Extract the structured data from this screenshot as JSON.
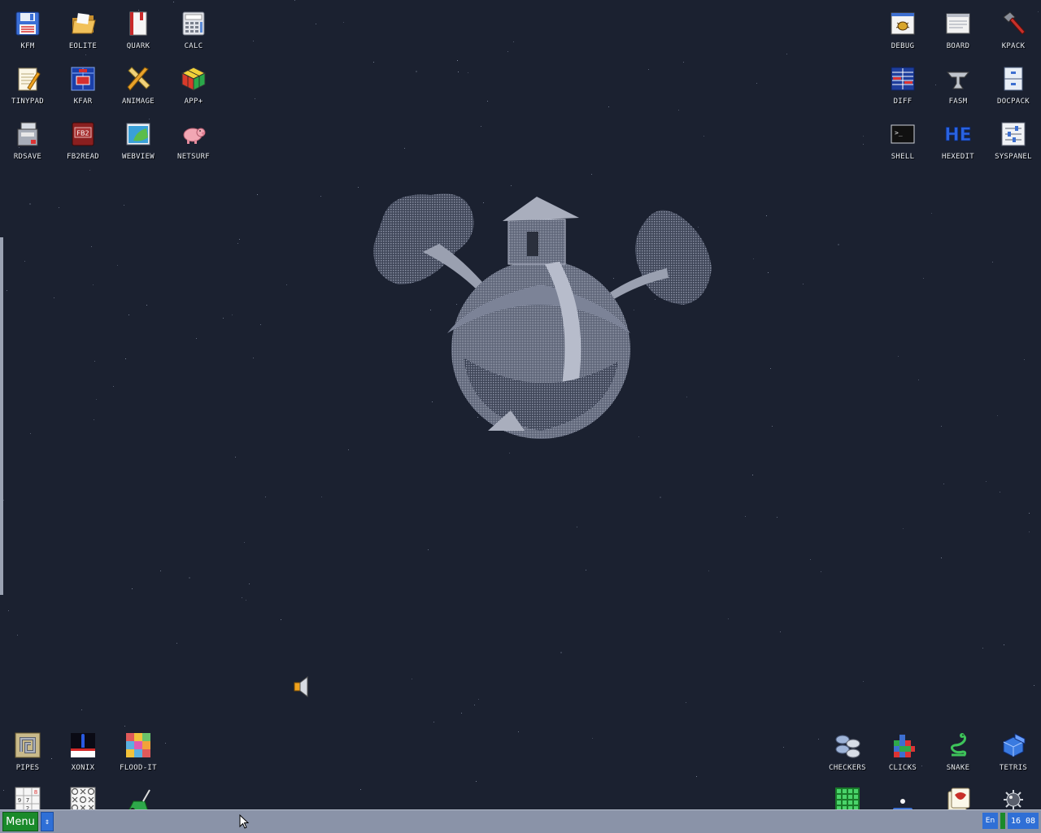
{
  "desktop": {
    "top_left_icons": [
      {
        "label": "KFM",
        "icon": "floppy-disk-icon"
      },
      {
        "label": "EOLITE",
        "icon": "folder-icon"
      },
      {
        "label": "QUARK",
        "icon": "book-icon"
      },
      {
        "label": "CALC",
        "icon": "calculator-icon"
      },
      {
        "label": "TINYPAD",
        "icon": "notepad-icon"
      },
      {
        "label": "KFAR",
        "icon": "archive-grid-icon"
      },
      {
        "label": "ANIMAGE",
        "icon": "pencil-ruler-icon"
      },
      {
        "label": "APP+",
        "icon": "cube-icon"
      },
      {
        "label": "RDSAVE",
        "icon": "disk-save-icon"
      },
      {
        "label": "FB2READ",
        "icon": "fb2-book-icon"
      },
      {
        "label": "WEBVIEW",
        "icon": "globe-window-icon"
      },
      {
        "label": "NETSURF",
        "icon": "pig-icon"
      }
    ],
    "top_right_icons": [
      {
        "label": "DEBUG",
        "icon": "bug-window-icon"
      },
      {
        "label": "BOARD",
        "icon": "board-window-icon"
      },
      {
        "label": "KPACK",
        "icon": "hammer-icon"
      },
      {
        "label": "DIFF",
        "icon": "diff-table-icon"
      },
      {
        "label": "FASM",
        "icon": "anvil-icon"
      },
      {
        "label": "DOCPACK",
        "icon": "cabinet-icon"
      },
      {
        "label": "SHELL",
        "icon": "terminal-icon"
      },
      {
        "label": "HEXEDIT",
        "icon": "he-logo-icon",
        "glyph_text": "HE"
      },
      {
        "label": "SYSPANEL",
        "icon": "sliders-icon"
      }
    ],
    "bottom_left_icons": [
      {
        "label": "PIPES",
        "icon": "pipes-icon"
      },
      {
        "label": "XONIX",
        "icon": "xonix-icon"
      },
      {
        "label": "FLOOD-IT",
        "icon": "color-grid-icon"
      }
    ],
    "bottom_left_partial_icons": [
      {
        "icon": "sudoku-icon"
      },
      {
        "icon": "tic-tac-toe-icon"
      },
      {
        "icon": "lawnmower-icon"
      }
    ],
    "bottom_right_icons": [
      {
        "label": "CHECKERS",
        "icon": "checkers-icon"
      },
      {
        "label": "CLICKS",
        "icon": "clicks-blocks-icon"
      },
      {
        "label": "SNAKE",
        "icon": "snake-icon"
      },
      {
        "label": "TETRIS",
        "icon": "tetris-block-icon"
      }
    ],
    "bottom_right_partial_icons": [
      {
        "icon": "green-grid-icon"
      },
      {
        "icon": "paddle-ball-icon"
      },
      {
        "icon": "mahjong-icon"
      },
      {
        "icon": "mine-icon"
      }
    ],
    "wallpaper": "treehouse-planet-icon",
    "volume": "speaker-icon"
  },
  "taskbar": {
    "menu_label": "Menu",
    "task_switch_glyph": "⇕",
    "language": "En",
    "clock": "16 08"
  },
  "colors": {
    "desktop_bg": "#1b2130",
    "taskbar_bg": "#8a93a8",
    "menu_green": "#1a8a2a",
    "accent_blue": "#2f6fd6"
  }
}
